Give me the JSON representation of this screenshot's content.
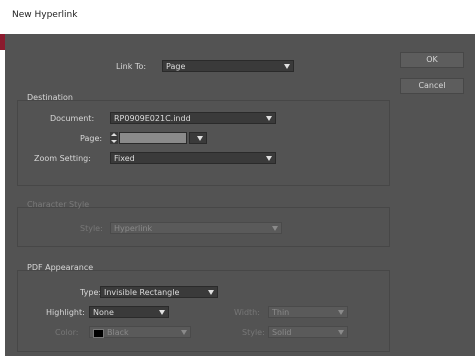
{
  "window": {
    "title": "New Hyperlink"
  },
  "link_to": {
    "label": "Link To:",
    "value": "Page"
  },
  "destination": {
    "title": "Destination",
    "document_label": "Document:",
    "document_value": "RP0909E021C.indd",
    "page_label": "Page:",
    "page_value": "",
    "zoom_label": "Zoom Setting:",
    "zoom_value": "Fixed"
  },
  "character_style": {
    "title": "Character Style",
    "style_label": "Style:",
    "style_value": "Hyperlink"
  },
  "pdf_appearance": {
    "title": "PDF Appearance",
    "type_label": "Type:",
    "type_value": "Invisible Rectangle",
    "highlight_label": "Highlight:",
    "highlight_value": "None",
    "width_label": "Width:",
    "width_value": "Thin",
    "color_label": "Color:",
    "color_value": "Black",
    "style_label": "Style:",
    "style_value": "Solid"
  },
  "buttons": {
    "ok": "OK",
    "cancel": "Cancel"
  }
}
